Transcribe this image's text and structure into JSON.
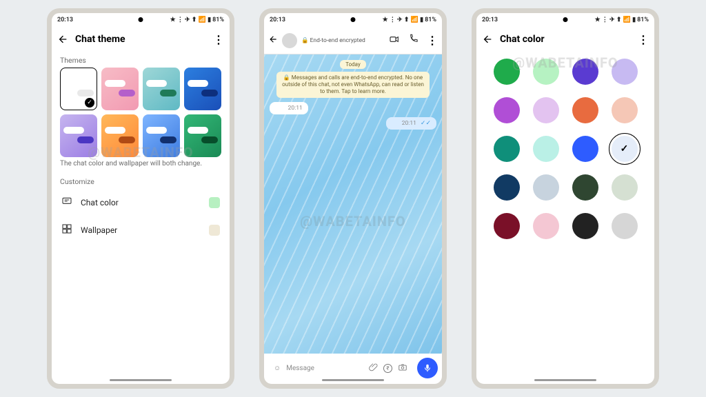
{
  "status": {
    "time": "20:13",
    "battery": "81%",
    "indicators": "★ ⋮ ✈ ⬆ 📶 ▮"
  },
  "watermark": "@WABETAINFO",
  "p1": {
    "title": "Chat theme",
    "section_themes": "Themes",
    "themes": [
      {
        "bg": "#ffffff",
        "bubble": "#e9e9e9",
        "selected": true
      },
      {
        "bg": "linear-gradient(140deg,#f7bcc6,#f29ab2)",
        "bubble": "#b45fca"
      },
      {
        "bg": "linear-gradient(140deg,#9ed7d7,#5fb9c4)",
        "bubble": "#1f7a57"
      },
      {
        "bg": "linear-gradient(140deg,#2c7fe0,#1a4fb8)",
        "bubble": "#0d2f7c"
      },
      {
        "bg": "linear-gradient(140deg,#c6b5ef,#9b7de4)",
        "bubble": "#4b36c3"
      },
      {
        "bg": "linear-gradient(140deg,#ffb85a,#ff8a3a)",
        "bubble": "#b04a15"
      },
      {
        "bg": "linear-gradient(140deg,#7fb5ff,#3e7ce0)",
        "bubble": "#12306e"
      },
      {
        "bg": "linear-gradient(140deg,#33b777,#1a8a55)",
        "bubble": "#074e2b"
      }
    ],
    "help": "The chat color and wallpaper will both change.",
    "section_customize": "Customize",
    "chat_color_label": "Chat color",
    "chat_color_swatch": "#b7f0c1",
    "wallpaper_label": "Wallpaper",
    "wallpaper_swatch": "#efe8d6"
  },
  "p2": {
    "encrypted_label": "End-to-end encrypted",
    "date": "Today",
    "banner": "🔒 Messages and calls are end-to-end encrypted. No one outside of this chat, not even WhatsApp, can read or listen to them. Tap to learn more.",
    "msg_in_time": "20:11",
    "msg_out_time": "20:11",
    "placeholder": "Message"
  },
  "p3": {
    "title": "Chat color",
    "colors": [
      "#1fab4b",
      "#b6f2c2",
      "#5a3bd1",
      "#c7baf2",
      "#b04ed6",
      "#e3c3f0",
      "#e86b3f",
      "#f5c7b6",
      "#0f8f7a",
      "#baf0e6",
      "#2e5cff",
      "#e5edf9",
      "#113a63",
      "#c7d3de",
      "#2f4631",
      "#d5e0d2",
      "#7a1028",
      "#f4c7d3",
      "#222222",
      "#d6d6d6"
    ],
    "selected_index": 11
  }
}
